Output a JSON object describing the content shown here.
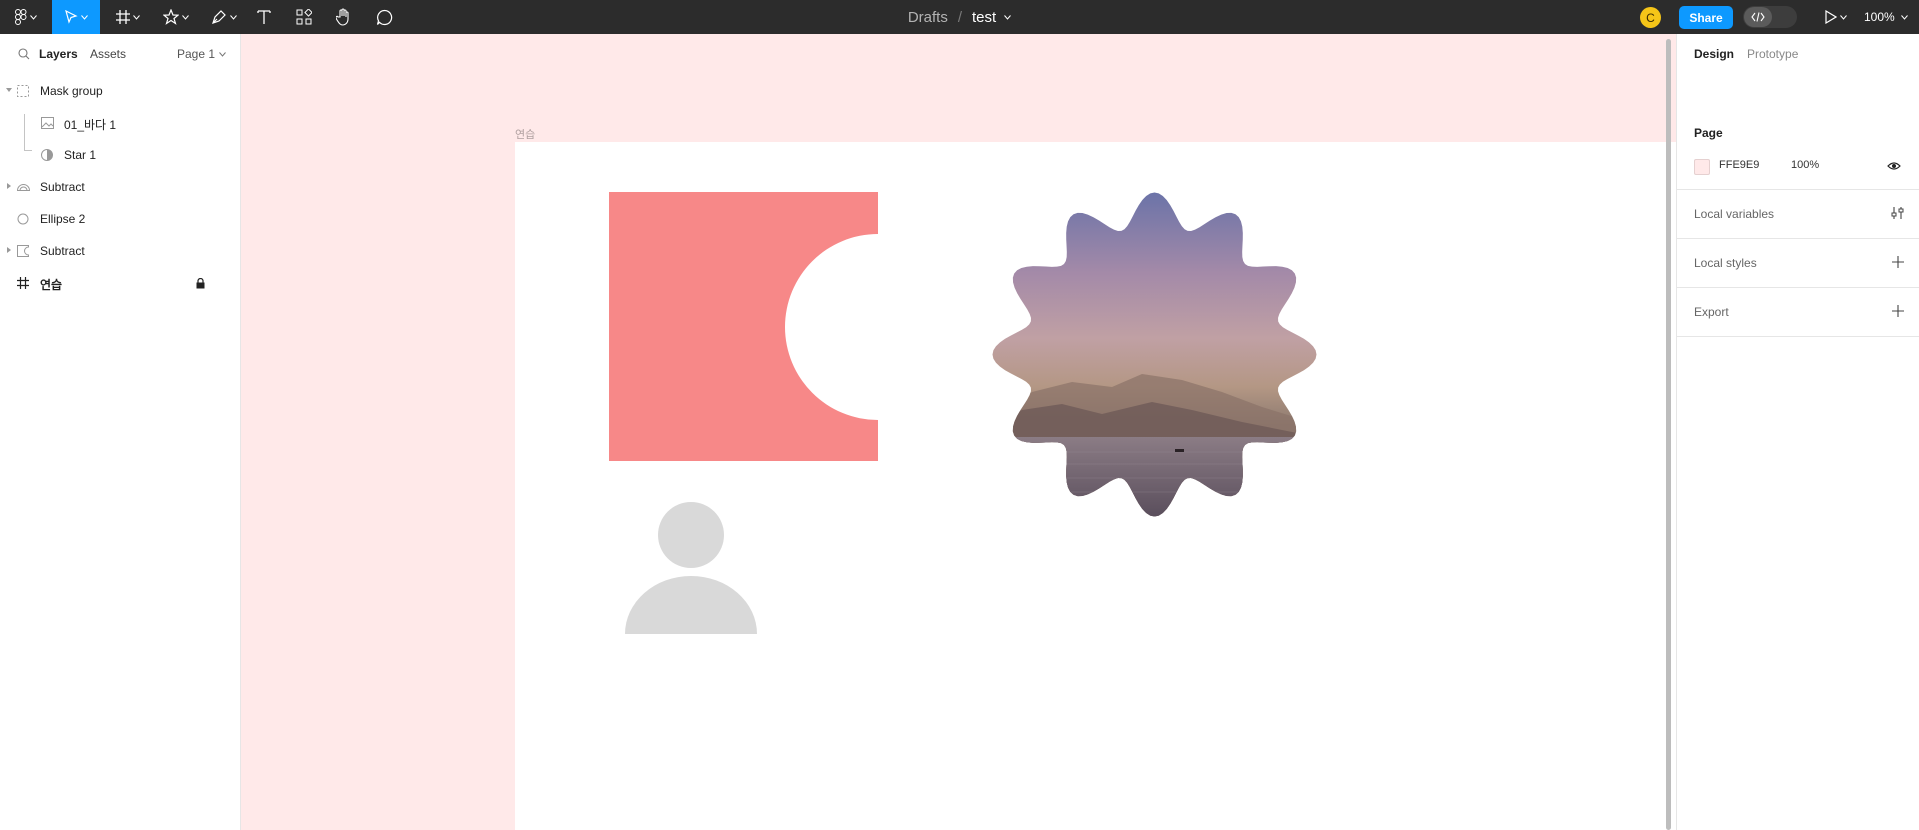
{
  "toolbar": {
    "tools": [
      {
        "name": "figma-menu-icon"
      },
      {
        "name": "move-tool-icon",
        "active": true
      },
      {
        "name": "frame-tool-icon"
      },
      {
        "name": "shape-tool-icon"
      },
      {
        "name": "pen-tool-icon"
      },
      {
        "name": "text-tool-icon"
      },
      {
        "name": "resources-icon"
      },
      {
        "name": "hand-tool-icon"
      },
      {
        "name": "comment-icon"
      }
    ],
    "breadcrumb_folder": "Drafts",
    "breadcrumb_separator": "/",
    "file_name": "test",
    "avatar_initial": "C",
    "share_label": "Share",
    "zoom": "100%",
    "accent_color": "#0d99ff",
    "avatar_color": "#f5c518"
  },
  "left_panel": {
    "tabs": [
      "Layers",
      "Assets"
    ],
    "page_selector": "Page 1",
    "layers": [
      {
        "name": "Mask group",
        "icon": "mask-group-icon",
        "expanded": true
      },
      {
        "name": "01_바다 1",
        "icon": "image-icon"
      },
      {
        "name": "Star 1",
        "icon": "mask-icon"
      },
      {
        "name": "Subtract",
        "icon": "subtract-icon",
        "collapsed": true
      },
      {
        "name": "Ellipse 2",
        "icon": "ellipse-icon"
      },
      {
        "name": "Subtract",
        "icon": "subtract-icon",
        "collapsed": true
      },
      {
        "name": "연습",
        "icon": "frame-icon",
        "locked": true
      }
    ]
  },
  "canvas": {
    "background": "#FFE9E9",
    "frame_label": "연습",
    "shape_color": "#f78888",
    "avatar_color": "#d9d9d9"
  },
  "right_panel": {
    "tabs": [
      "Design",
      "Prototype"
    ],
    "page_heading": "Page",
    "page_color_hex": "FFE9E9",
    "page_opacity": "100%",
    "local_variables_label": "Local variables",
    "local_styles_label": "Local styles",
    "export_label": "Export"
  }
}
